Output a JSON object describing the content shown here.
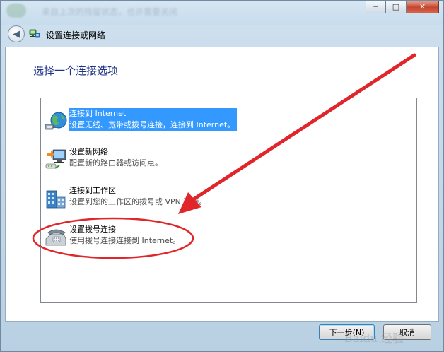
{
  "window": {
    "blurred_title": "来自上次的残留状态，也许需要关闭",
    "minimize_glyph": "─",
    "maximize_glyph": "□",
    "close_glyph": "✕"
  },
  "nav": {
    "back_glyph": "◀",
    "title": "设置连接或网络"
  },
  "heading": "选择一个连接选项",
  "options": [
    {
      "title": "连接到 Internet",
      "desc": "设置无线、宽带或拨号连接，连接到 Internet。",
      "icon": "globe-network-icon",
      "selected": true
    },
    {
      "title": "设置新网络",
      "desc": "配置新的路由器或访问点。",
      "icon": "router-network-icon",
      "selected": false
    },
    {
      "title": "连接到工作区",
      "desc": "设置到您的工作区的拨号或 VPN 连接。",
      "icon": "workplace-building-icon",
      "selected": false
    },
    {
      "title": "设置拨号连接",
      "desc": "使用拨号连接连接到 Internet。",
      "icon": "dialup-phone-icon",
      "selected": false
    }
  ],
  "buttons": {
    "next": "下一步(N)",
    "cancel": "取消"
  },
  "annotation": {
    "color": "#e0262b"
  },
  "watermark": "Baidu 经验"
}
